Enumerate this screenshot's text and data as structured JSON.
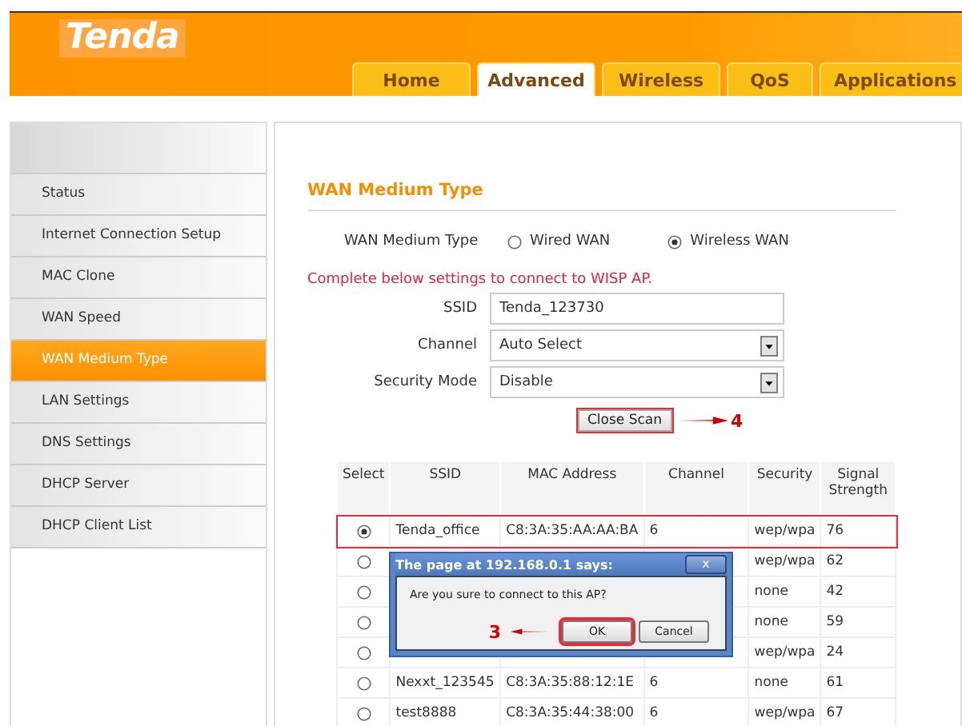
{
  "header": {
    "logo": "Tenda",
    "tabs": [
      {
        "label": "Home",
        "selected": false
      },
      {
        "label": "Advanced",
        "selected": true
      },
      {
        "label": "Wireless",
        "selected": false
      },
      {
        "label": "QoS",
        "selected": false
      },
      {
        "label": "Applications",
        "selected": false
      }
    ]
  },
  "sidebar": {
    "items": [
      {
        "label": "Status",
        "selected": false
      },
      {
        "label": "Internet Connection Setup",
        "selected": false
      },
      {
        "label": "MAC Clone",
        "selected": false
      },
      {
        "label": "WAN Speed",
        "selected": false
      },
      {
        "label": "WAN Medium Type",
        "selected": true
      },
      {
        "label": "LAN Settings",
        "selected": false
      },
      {
        "label": "DNS Settings",
        "selected": false
      },
      {
        "label": "DHCP Server",
        "selected": false
      },
      {
        "label": "DHCP Client List",
        "selected": false
      }
    ]
  },
  "content": {
    "title": "WAN Medium Type",
    "medium_type": {
      "label": "WAN Medium Type",
      "options": [
        {
          "label": "Wired WAN",
          "selected": false
        },
        {
          "label": "Wireless WAN",
          "selected": true
        }
      ]
    },
    "notice": "Complete below settings to connect to WISP AP.",
    "fields": [
      {
        "kind": "text",
        "label": "SSID",
        "value": "Tenda_123730"
      },
      {
        "kind": "select",
        "label": "Channel",
        "value": "Auto Select"
      },
      {
        "kind": "select",
        "label": "Security Mode",
        "value": "Disable"
      }
    ],
    "close_scan_button": {
      "label": "Close Scan",
      "marker": "4"
    },
    "table": {
      "columns": [
        "Select",
        "SSID",
        "MAC Address",
        "Channel",
        "Security",
        "Signal Strength"
      ],
      "rows": [
        {
          "selected": true,
          "highlighted": true,
          "ssid": "Tenda_office",
          "mac": "C8:3A:35:AA:AA:BA",
          "channel": "6",
          "security": "wep/wpa",
          "signal": "76"
        },
        {
          "selected": false,
          "highlighted": false,
          "security": "wep/wpa",
          "signal": "62"
        },
        {
          "selected": false,
          "highlighted": false,
          "security": "none",
          "signal": "42"
        },
        {
          "selected": false,
          "highlighted": false,
          "security": "none",
          "signal": "59"
        },
        {
          "selected": false,
          "highlighted": false,
          "security": "wep/wpa",
          "signal": "24"
        },
        {
          "selected": false,
          "highlighted": false,
          "ssid": "Nexxt_123545",
          "mac": "C8:3A:35:88:12:1E",
          "channel": "6",
          "security": "none",
          "signal": "61"
        },
        {
          "selected": false,
          "highlighted": false,
          "ssid": "test8888",
          "mac": "C8:3A:35:44:38:00",
          "channel": "6",
          "security": "wep/wpa",
          "signal": "67"
        }
      ]
    }
  },
  "dialog": {
    "title": "The page at 192.168.0.1 says:",
    "close": "x",
    "message": "Are you sure to connect to this AP?",
    "buttons": [
      {
        "label": "OK",
        "marker": "3"
      },
      {
        "label": "Cancel"
      }
    ]
  }
}
